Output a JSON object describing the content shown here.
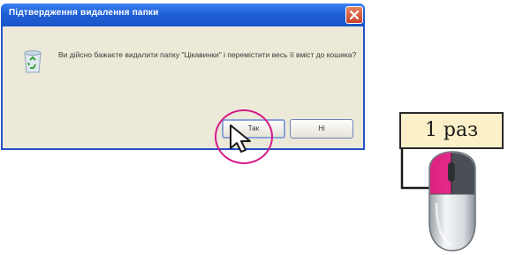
{
  "dialog": {
    "title": "Підтвердження видалення папки",
    "message": "Ви дійсно бажаєте видалити папку \"Цікавинки\" і перемістити весь її вміст до кошика?",
    "buttons": {
      "yes": "Так",
      "no": "Ні"
    },
    "icon": "recycle-bin-icon"
  },
  "annotation": {
    "clicks_label": "1 раз"
  },
  "colors": {
    "titlebar": "#1f5fd6",
    "highlight": "#d41a8a",
    "label_bg": "#fbf0c8"
  }
}
